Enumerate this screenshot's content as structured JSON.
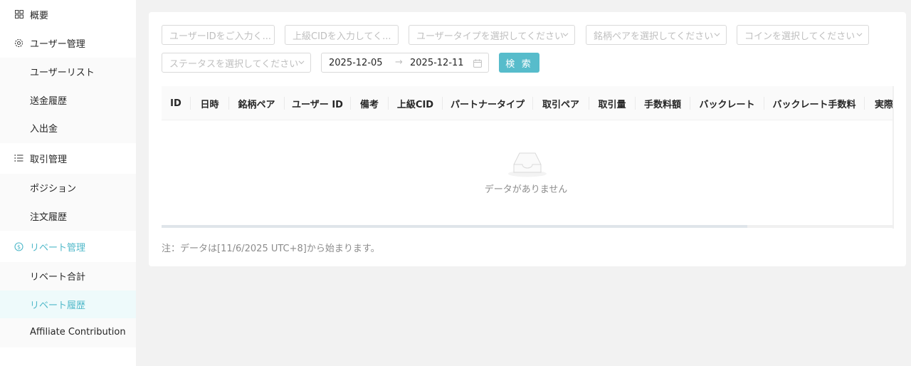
{
  "sidebar": {
    "overview": "概要",
    "user_mgmt": "ユーザー管理",
    "user_items": [
      "ユーザーリスト",
      "送金履歴",
      "入出金"
    ],
    "trade_mgmt": "取引管理",
    "trade_items": [
      "ポジション",
      "注文履歴"
    ],
    "rebate_mgmt": "リベート管理",
    "rebate_items": [
      "リベート合計",
      "リベート履歴",
      "Affiliate Contribution"
    ]
  },
  "filters": {
    "user_id_placeholder": "ユーザーIDをご入力く...",
    "upper_cid_placeholder": "上級CIDを入力してく...",
    "user_type_placeholder": "ユーザータイプを選択してください",
    "pair_placeholder": "銘柄ペアを選択してください",
    "coin_placeholder": "コインを選択してください",
    "status_placeholder": "ステータスを選択してください",
    "date_from": "2025-12-05",
    "date_sep": "→",
    "date_to": "2025-12-11",
    "search_label": "検 索"
  },
  "table": {
    "headers": [
      "ID",
      "日時",
      "銘柄ペア",
      "ユーザー ID",
      "備考",
      "上級CID",
      "パートナータイプ",
      "取引ペア",
      "取引量",
      "手数料額",
      "バックレート",
      "バックレート手数料",
      "実際"
    ],
    "empty_text": "データがありません"
  },
  "note": "注：データは[11/6/2025 UTC+8]から始まります。",
  "colors": {
    "accent": "#57bccb",
    "active_text": "#4fb8c9",
    "selected_bg": "#eefafb"
  },
  "icons": {
    "overview": "grid-icon",
    "user": "gear-icon",
    "trade": "list-icon",
    "rebate": "dollar-circle-icon"
  }
}
